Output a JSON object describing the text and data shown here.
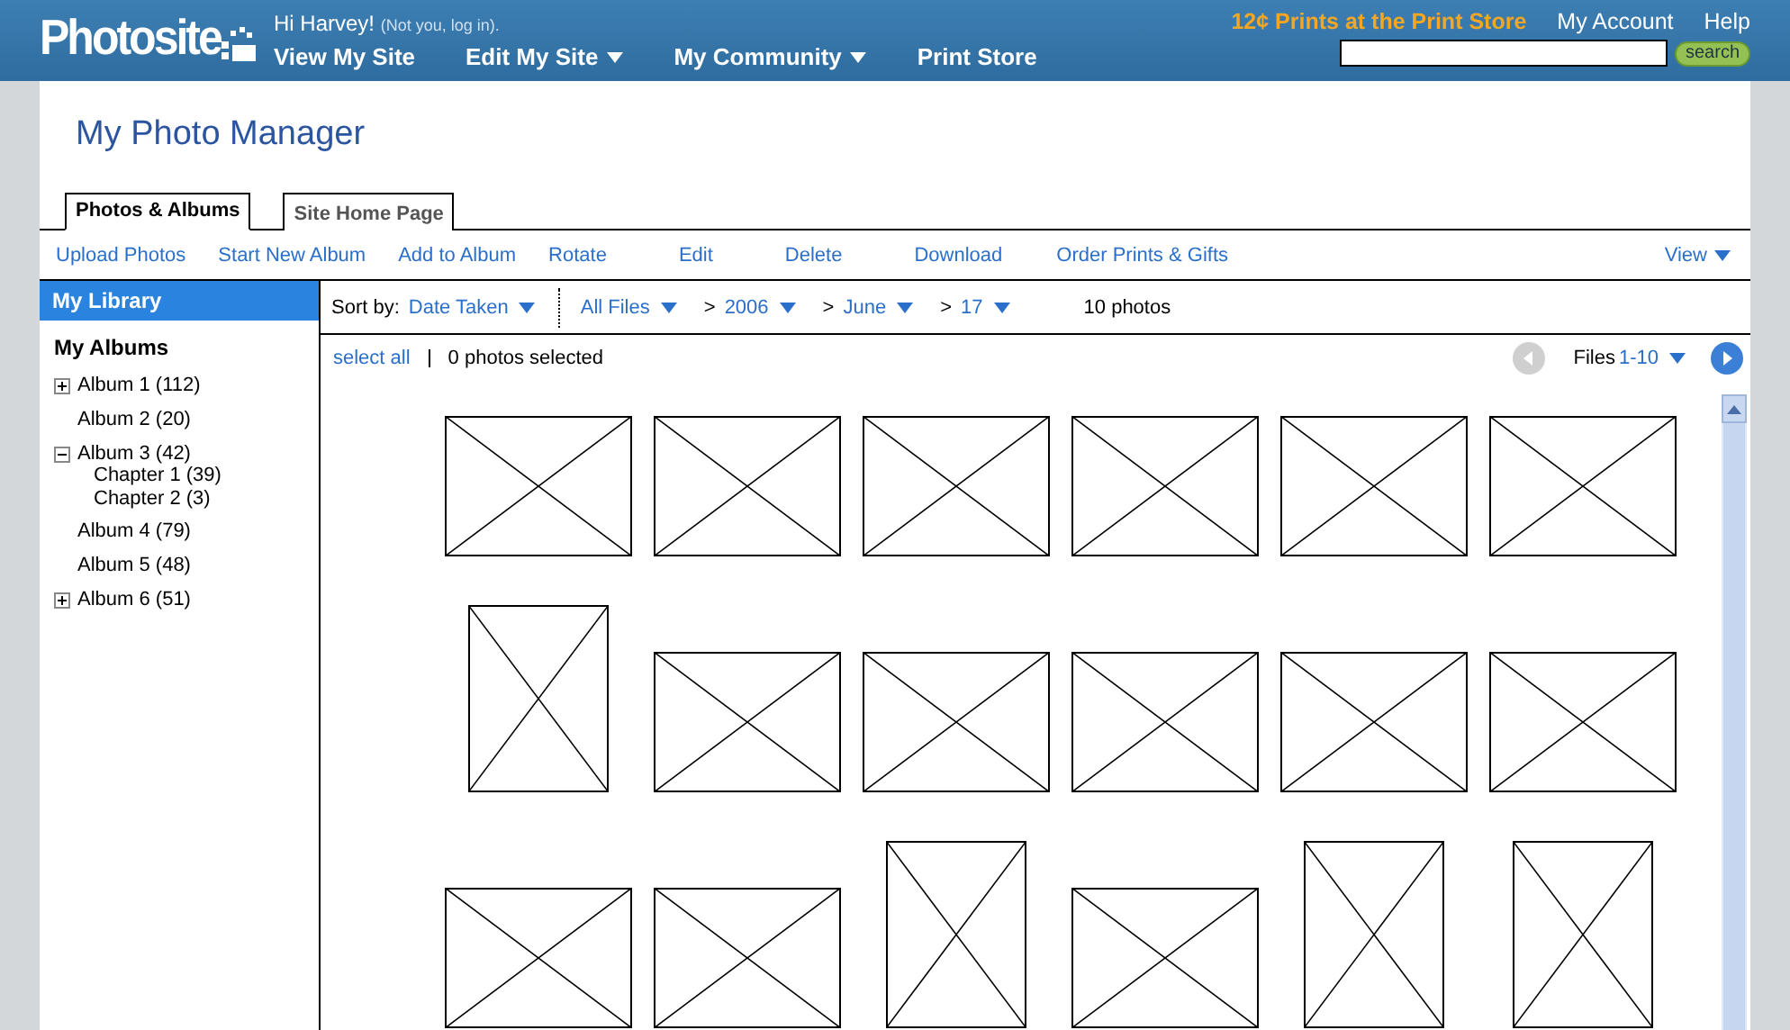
{
  "header": {
    "logo": "Photosite",
    "greeting": "Hi Harvey!",
    "login_note": "(Not you, log in).",
    "nav": [
      {
        "label": "View My Site",
        "dropdown": false
      },
      {
        "label": "Edit My Site",
        "dropdown": true
      },
      {
        "label": "My Community",
        "dropdown": true
      },
      {
        "label": "Print Store",
        "dropdown": false
      }
    ],
    "promo": "12¢ Prints at the Print Store",
    "links": [
      "My Account",
      "Help"
    ],
    "search_button": "search"
  },
  "page_title": "My Photo Manager",
  "tabs": [
    {
      "label": "Photos & Albums",
      "selected": true
    },
    {
      "label": "Site Home Page",
      "selected": false
    }
  ],
  "toolbar": [
    "Upload Photos",
    "Start New Album",
    "Add to Album",
    "Rotate",
    "Edit",
    "Delete",
    "Download",
    "Order Prints & Gifts"
  ],
  "view_menu": "View",
  "sidebar": {
    "header": "My Library",
    "section": "My Albums",
    "albums": [
      {
        "label": "Album 1 (112)",
        "kind": "expandable",
        "expanded": false
      },
      {
        "label": "Album 2 (20)",
        "kind": "leaf"
      },
      {
        "label": "Album 3 (42)",
        "kind": "expandable",
        "expanded": true,
        "children": [
          {
            "label": "Chapter 1 (39)"
          },
          {
            "label": "Chapter 2 (3)"
          }
        ]
      },
      {
        "label": "Album 4 (79)",
        "kind": "leaf"
      },
      {
        "label": "Album 5 (48)",
        "kind": "leaf"
      },
      {
        "label": "Album 6 (51)",
        "kind": "expandable",
        "expanded": false
      }
    ]
  },
  "sort_bar": {
    "sort_label": "Sort by:",
    "sort_value": "Date Taken",
    "filter": "All Files",
    "path": [
      {
        "separator": ">",
        "label": "2006"
      },
      {
        "separator": ">",
        "label": "June"
      },
      {
        "separator": ">",
        "label": "17"
      }
    ],
    "count": "10 photos"
  },
  "selection": {
    "select_all": "select all",
    "selected_count": "0 photos selected",
    "files_label": "Files",
    "files_range": "1-10",
    "prev_disabled": true,
    "next_disabled": false
  },
  "photos": [
    {
      "kind": "landscape"
    },
    {
      "kind": "landscape"
    },
    {
      "kind": "landscape"
    },
    {
      "kind": "landscape"
    },
    {
      "kind": "landscape"
    },
    {
      "kind": "landscape"
    },
    {
      "kind": "portrait"
    },
    {
      "kind": "landscape"
    },
    {
      "kind": "landscape"
    },
    {
      "kind": "landscape"
    },
    {
      "kind": "landscape"
    },
    {
      "kind": "landscape"
    },
    {
      "kind": "landscape"
    },
    {
      "kind": "landscape"
    },
    {
      "kind": "portrait"
    },
    {
      "kind": "landscape"
    },
    {
      "kind": "portrait"
    },
    {
      "kind": "portrait"
    }
  ]
}
